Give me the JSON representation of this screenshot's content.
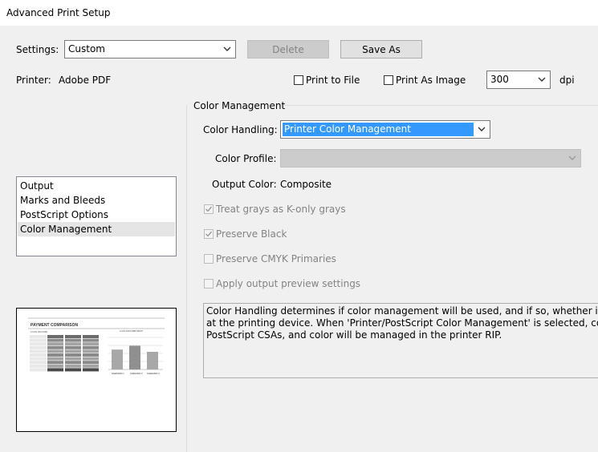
{
  "window": {
    "title": "Advanced Print Setup"
  },
  "settings": {
    "label": "Settings:",
    "value": "Custom",
    "delete_label": "Delete",
    "save_as_label": "Save As"
  },
  "printer": {
    "label": "Printer:",
    "value": "Adobe PDF",
    "print_to_file_label": "Print to File",
    "print_as_image_label": "Print As Image",
    "dpi_value": "300",
    "dpi_unit": "dpi"
  },
  "sidebar": {
    "items": [
      {
        "label": "Output"
      },
      {
        "label": "Marks and Bleeds"
      },
      {
        "label": "PostScript Options"
      },
      {
        "label": "Color Management"
      }
    ]
  },
  "color_management": {
    "section_title": "Color Management",
    "color_handling_label": "Color Handling:",
    "color_handling_value": "Printer Color Management",
    "color_profile_label": "Color Profile:",
    "color_profile_value": "",
    "output_color_label": "Output Color:",
    "output_color_value": "Composite",
    "options": [
      {
        "label": "Treat grays as K-only grays",
        "checked": true
      },
      {
        "label": "Preserve Black",
        "checked": true
      },
      {
        "label": "Preserve CMYK Primaries",
        "checked": false
      },
      {
        "label": "Apply output preview settings",
        "checked": false
      }
    ],
    "description": "Color Handling determines if color management will be used, and if so, whether it happens in\nat the printing device. When 'Printer/PostScript Color Management' is selected, convert any l\nPostScript CSAs, and color will be managed in the printer RIP."
  },
  "preview": {
    "title": "PAYMENT COMPARISON",
    "subtitle": "LOAN INCOME",
    "chart_headers": [
      "LOAN AMOUNT",
      "PAYMENT"
    ],
    "chart_labels": [
      "SCENARIO 1",
      "SCENARIO 2",
      "SCENARIO 3"
    ],
    "bar_values": [
      0.62,
      0.74,
      0.55
    ]
  },
  "colors": {
    "accent": "#3399ff",
    "selected_text": "#ffffff"
  }
}
